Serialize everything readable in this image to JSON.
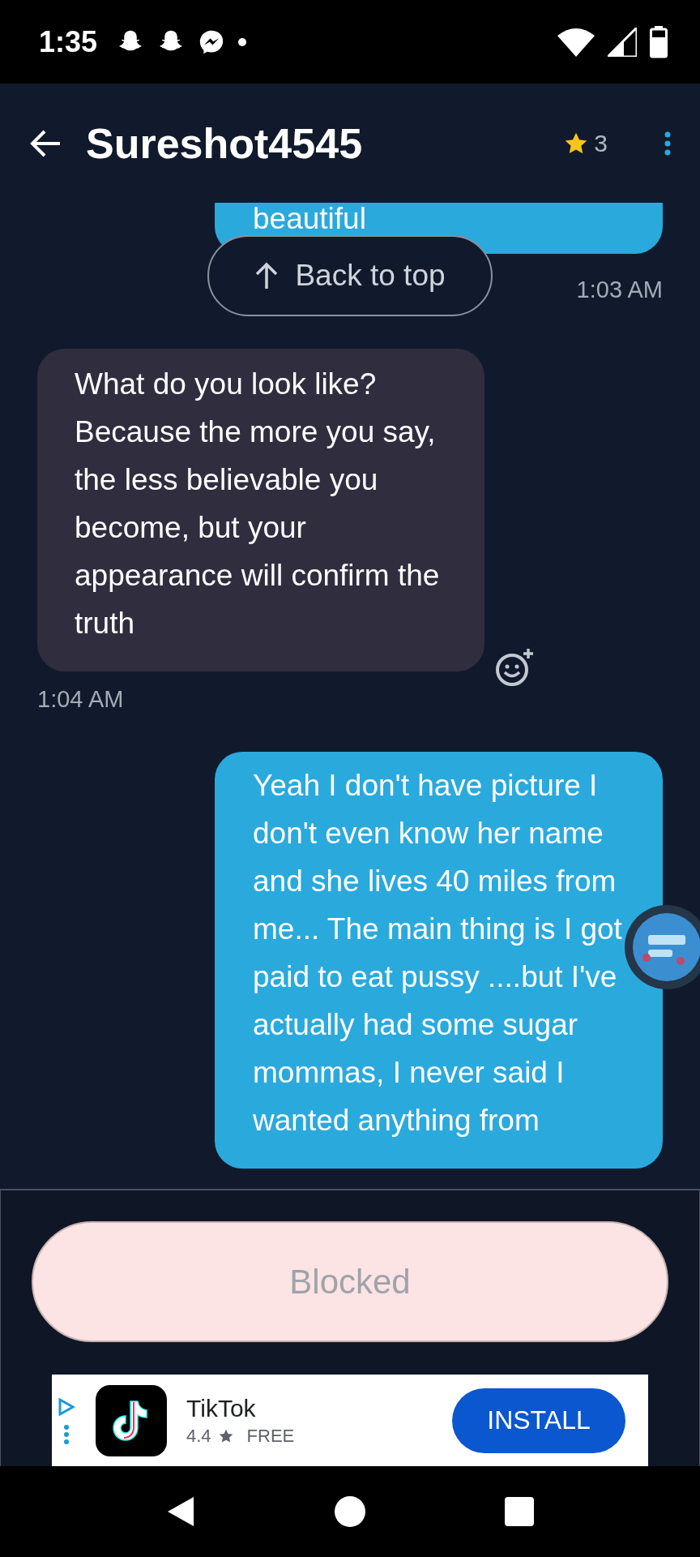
{
  "status_bar": {
    "time": "1:35"
  },
  "header": {
    "title": "Sureshot4545",
    "star_count": "3"
  },
  "messages": [
    {
      "kind": "outgoing",
      "text": "beautiful",
      "time": "1:03 AM"
    },
    {
      "kind": "incoming",
      "text": "What do you look like? Because the more you say, the less believable you become, but your appearance will confirm the truth",
      "time": "1:04 AM"
    },
    {
      "kind": "outgoing",
      "text": "Yeah I don't have picture I don't even know her name and she lives 40 miles from me... The main thing is I got paid to eat pussy ....but I've actually had some sugar mommas, I never said I wanted anything from"
    }
  ],
  "back_to_top": {
    "label": "Back to top"
  },
  "composer": {
    "label": "Blocked",
    "disabled": true
  },
  "ad": {
    "app_name": "TikTok",
    "rating": "4.4",
    "price": "FREE",
    "button": "INSTALL"
  }
}
